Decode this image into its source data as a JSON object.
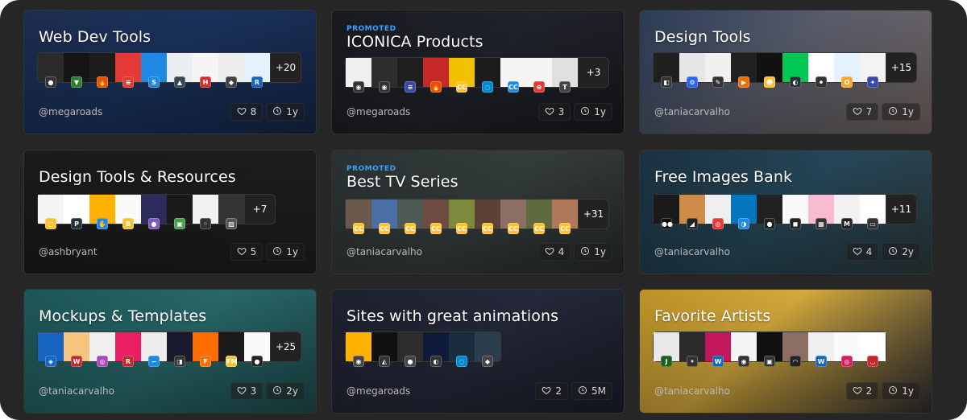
{
  "cards": [
    {
      "title": "Web Dev Tools",
      "promoted": "",
      "owner": "@megaroads",
      "likes": "8",
      "age": "1y",
      "more": "+20",
      "bg": "linear-gradient(135deg,#1f2f52 0%,#1b3561 45%,#16294b 100%)",
      "thumbs": [
        {
          "c": "#2b2b2b",
          "f": "#333",
          "g": "●"
        },
        {
          "c": "#151515",
          "f": "#2e7d32",
          "g": "▼"
        },
        {
          "c": "#1d1d1d",
          "f": "#e65100",
          "g": "🔥"
        },
        {
          "c": "#e53935",
          "f": "#e53935",
          "g": "≡"
        },
        {
          "c": "#1e88e5",
          "f": "#1e88e5",
          "g": "S"
        },
        {
          "c": "#eceff1",
          "f": "#37474f",
          "g": "▲"
        },
        {
          "c": "#f5f5f5",
          "f": "#d32f2f",
          "g": "H"
        },
        {
          "c": "#eeeeee",
          "f": "#424242",
          "g": "◆"
        },
        {
          "c": "#e3f2fd",
          "f": "#1565c0",
          "g": "R"
        }
      ]
    },
    {
      "title": "ICONICA Products",
      "promoted": "PROMOTED",
      "owner": "@megaroads",
      "likes": "3",
      "age": "1y",
      "more": "+3",
      "bg": "linear-gradient(135deg,#1a1c22 0%,#22252d 50%,#1a1b20 100%)",
      "thumbs": [
        {
          "c": "#efefef",
          "f": "#333",
          "g": "◉"
        },
        {
          "c": "#2c2c2c",
          "f": "#333",
          "g": "◉"
        },
        {
          "c": "#1f1f1f",
          "f": "#3949ab",
          "g": "≡"
        },
        {
          "c": "#c62828",
          "f": "#e65100",
          "g": "🔥"
        },
        {
          "c": "#f2c200",
          "f": "#fbc02d",
          "g": "CC"
        },
        {
          "c": "#1c1c1c",
          "f": "#0288d1",
          "g": "◌"
        },
        {
          "c": "#f4f4f4",
          "f": "#1e88e5",
          "g": "CC"
        },
        {
          "c": "#f5f5f5",
          "f": "#e53935",
          "g": "⊕"
        },
        {
          "c": "#e0e0e0",
          "f": "#444",
          "g": "T"
        }
      ]
    },
    {
      "title": "Design Tools",
      "promoted": "",
      "owner": "@taniacarvalho",
      "likes": "7",
      "age": "1y",
      "more": "+15",
      "bg": "linear-gradient(135deg,#2d3f5c 0%,#5d6272 45%,#7a6c66 100%)",
      "thumbs": [
        {
          "c": "#1f1f1f",
          "f": "#333",
          "g": "◧"
        },
        {
          "c": "#e6e6e6",
          "f": "#2962ff",
          "g": "⚙"
        },
        {
          "c": "#f0f0f0",
          "f": "#333",
          "g": "✎"
        },
        {
          "c": "#212121",
          "f": "#ef6c00",
          "g": "▶"
        },
        {
          "c": "#111",
          "f": "#fbc02d",
          "g": "☻"
        },
        {
          "c": "#00c853",
          "f": "#263238",
          "g": "◐"
        },
        {
          "c": "#ffffff",
          "f": "#333",
          "g": "⚫"
        },
        {
          "c": "#e3f2fd",
          "f": "#f9a825",
          "g": "O"
        },
        {
          "c": "#f3f3f3",
          "f": "#3949ab",
          "g": "✦"
        }
      ]
    },
    {
      "title": "Design Tools & Resources",
      "promoted": "",
      "owner": "@ashbryant",
      "likes": "5",
      "age": "1y",
      "more": "+7",
      "bg": "linear-gradient(135deg,#1c1c1e 0%,#202022 100%)",
      "thumbs": [
        {
          "c": "#f4f4f4",
          "f": "#fbc02d",
          "g": "▢"
        },
        {
          "c": "#ffffff",
          "f": "#263238",
          "g": "P"
        },
        {
          "c": "#ffb300",
          "f": "#1e88e5",
          "g": "✋"
        },
        {
          "c": "#fafafa",
          "f": "#fbc02d",
          "g": "B"
        },
        {
          "c": "#2c2c5a",
          "f": "#7e57c2",
          "g": "●"
        },
        {
          "c": "#1a1a1a",
          "f": "#43a047",
          "g": "▣"
        },
        {
          "c": "#f2f2f2",
          "f": "#333",
          "g": "◦"
        },
        {
          "c": "#333333",
          "f": "#555",
          "g": "▨"
        }
      ]
    },
    {
      "title": "Best TV Series",
      "promoted": "PROMOTED",
      "owner": "@taniacarvalho",
      "likes": "4",
      "age": "1y",
      "more": "+31",
      "bg": "linear-gradient(135deg,#2c3436 0%,#38413f 50%,#2a2e2e 100%)",
      "thumbs": [
        {
          "c": "#6b5a4b",
          "f": "#fbc02d",
          "g": "CC"
        },
        {
          "c": "#4a6fa5",
          "f": "#fbc02d",
          "g": "CC"
        },
        {
          "c": "#4e5b55",
          "f": "#fbc02d",
          "g": "CC"
        },
        {
          "c": "#6d4c41",
          "f": "#fbc02d",
          "g": "CC"
        },
        {
          "c": "#7b8a3c",
          "f": "#fbc02d",
          "g": "CC"
        },
        {
          "c": "#5d4037",
          "f": "#fbc02d",
          "g": "CC"
        },
        {
          "c": "#8d6e63",
          "f": "#fbc02d",
          "g": "CC"
        },
        {
          "c": "#5e6b3f",
          "f": "#fbc02d",
          "g": "CC"
        },
        {
          "c": "#b0785a",
          "f": "#fbc02d",
          "g": "CC"
        }
      ]
    },
    {
      "title": "Free Images Bank",
      "promoted": "",
      "owner": "@taniacarvalho",
      "likes": "4",
      "age": "2y",
      "more": "+11",
      "bg": "linear-gradient(135deg,#1c3444 0%,#274c5e 50%,#2f3c40 100%)",
      "thumbs": [
        {
          "c": "#1a1a1a",
          "f": "#111",
          "g": "●●"
        },
        {
          "c": "#ce8b4a",
          "f": "#222",
          "g": "◢"
        },
        {
          "c": "#efefef",
          "f": "#e53935",
          "g": "◎"
        },
        {
          "c": "#0277bd",
          "f": "#1e88e5",
          "g": "◑"
        },
        {
          "c": "#222",
          "f": "#222",
          "g": "●"
        },
        {
          "c": "#fafafa",
          "f": "#222",
          "g": "◼"
        },
        {
          "c": "#f8bbd0",
          "f": "#333",
          "g": "▦"
        },
        {
          "c": "#f2f2f2",
          "f": "#222",
          "g": "M"
        },
        {
          "c": "#ffffff",
          "f": "#333",
          "g": "▭"
        }
      ]
    },
    {
      "title": "Mockups & Templates",
      "promoted": "",
      "owner": "@taniacarvalho",
      "likes": "3",
      "age": "2y",
      "more": "+25",
      "bg": "linear-gradient(135deg,#1f5b5c 0%,#2a6e6f 50%,#1f4f50 100%)",
      "thumbs": [
        {
          "c": "#1565c0",
          "f": "#1565c0",
          "g": "◈"
        },
        {
          "c": "#f5c580",
          "f": "#c62828",
          "g": "W"
        },
        {
          "c": "#f0f0f0",
          "f": "#ab47bc",
          "g": "◎"
        },
        {
          "c": "#e91e63",
          "f": "#c62828",
          "g": "R"
        },
        {
          "c": "#eeeeee",
          "f": "#1e88e5",
          "g": "∽"
        },
        {
          "c": "#1a1a2e",
          "f": "#333",
          "g": "◨"
        },
        {
          "c": "#ff6d00",
          "f": "#ff6d00",
          "g": "F"
        },
        {
          "c": "#1a1a1a",
          "f": "#fbc02d",
          "g": "FM"
        },
        {
          "c": "#fafafa",
          "f": "#222",
          "g": "●"
        }
      ]
    },
    {
      "title": "Sites with great animations",
      "promoted": "",
      "owner": "@megaroads",
      "likes": "2",
      "age": "5M",
      "more": "",
      "bg": "linear-gradient(135deg,#1f2330 0%,#272b3d 50%,#1c1f2b 100%)",
      "thumbs": [
        {
          "c": "#ffb300",
          "f": "#444",
          "g": "◉"
        },
        {
          "c": "#111",
          "f": "#333",
          "g": "◭"
        },
        {
          "c": "#2d2d2d",
          "f": "#444",
          "g": "●"
        },
        {
          "c": "#101a3a",
          "f": "#333",
          "g": "◐"
        },
        {
          "c": "#1a2d3e",
          "f": "#0288d1",
          "g": "◌"
        },
        {
          "c": "#2a3e4e",
          "f": "#444",
          "g": "◆"
        }
      ]
    },
    {
      "title": "Favorite Artists",
      "promoted": "",
      "owner": "@taniacarvalho",
      "likes": "2",
      "age": "1y",
      "more": "",
      "bg": "linear-gradient(135deg,#c89b2a 0%,#e0b340 40%,#2e2e32 100%)",
      "thumbs": [
        {
          "c": "#e8e8e8",
          "f": "#1b5e20",
          "g": "J"
        },
        {
          "c": "#2a2a2a",
          "f": "#333",
          "g": "•"
        },
        {
          "c": "#c2185b",
          "f": "#1565c0",
          "g": "W"
        },
        {
          "c": "#f5f5f5",
          "f": "#333",
          "g": "◉"
        },
        {
          "c": "#111",
          "f": "#333",
          "g": "▣"
        },
        {
          "c": "#8d6e63",
          "f": "#222",
          "g": "◠"
        },
        {
          "c": "#f0f0f0",
          "f": "#1565c0",
          "g": "W"
        },
        {
          "c": "#fafafa",
          "f": "#d81b60",
          "g": "◎"
        },
        {
          "c": "#ffffff",
          "f": "#c62828",
          "g": "◡"
        }
      ]
    }
  ]
}
